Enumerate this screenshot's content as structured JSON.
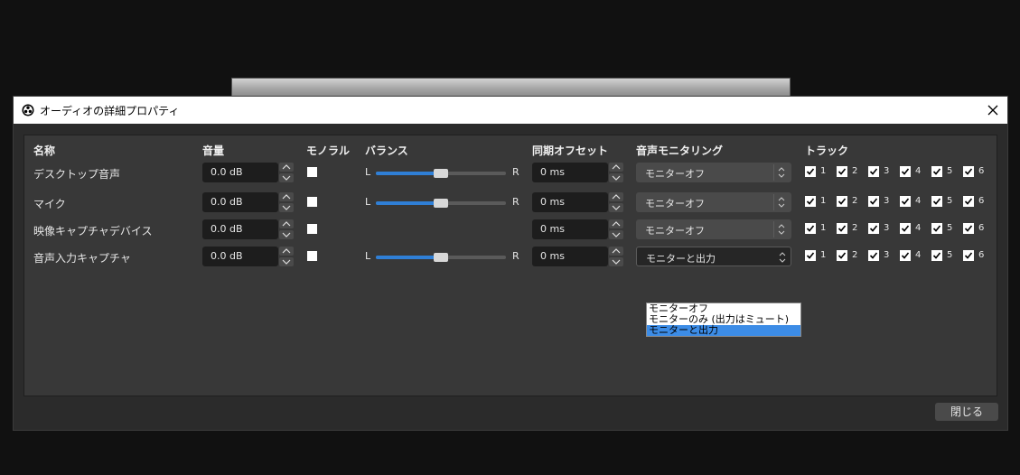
{
  "window": {
    "title": "オーディオの詳細プロパティ",
    "close_label": "閉じる"
  },
  "columns": {
    "name": "名称",
    "volume": "音量",
    "mono": "モノラル",
    "balance": "バランス",
    "sync_offset": "同期オフセット",
    "monitoring": "音声モニタリング",
    "tracks": "トラック"
  },
  "balance_labels": {
    "left": "L",
    "right": "R"
  },
  "rows": [
    {
      "name": "デスクトップ音声",
      "volume": "0.0 dB",
      "mono": false,
      "has_balance": true,
      "balance": 0.5,
      "offset": "0 ms",
      "monitoring": "モニターオフ",
      "tracks": [
        "1",
        "2",
        "3",
        "4",
        "5",
        "6"
      ]
    },
    {
      "name": "マイク",
      "volume": "0.0 dB",
      "mono": false,
      "has_balance": true,
      "balance": 0.5,
      "offset": "0 ms",
      "monitoring": "モニターオフ",
      "tracks": [
        "1",
        "2",
        "3",
        "4",
        "5",
        "6"
      ]
    },
    {
      "name": "映像キャプチャデバイス",
      "volume": "0.0 dB",
      "mono": false,
      "has_balance": false,
      "offset": "0 ms",
      "monitoring": "モニターオフ",
      "tracks": [
        "1",
        "2",
        "3",
        "4",
        "5",
        "6"
      ]
    },
    {
      "name": "音声入力キャプチャ",
      "volume": "0.0 dB",
      "mono": false,
      "has_balance": true,
      "balance": 0.5,
      "offset": "0 ms",
      "monitoring": "モニターと出力",
      "tracks": [
        "1",
        "2",
        "3",
        "4",
        "5",
        "6"
      ]
    }
  ],
  "monitor_dropdown": {
    "options": [
      "モニターオフ",
      "モニターのみ (出力はミュート)",
      "モニターと出力"
    ],
    "selected_index": 2
  },
  "colors": {
    "accent": "#2f7fd6",
    "dialog_bg": "#2b2b2b",
    "panel_bg": "#383838",
    "titlebar": "#ffffff"
  }
}
